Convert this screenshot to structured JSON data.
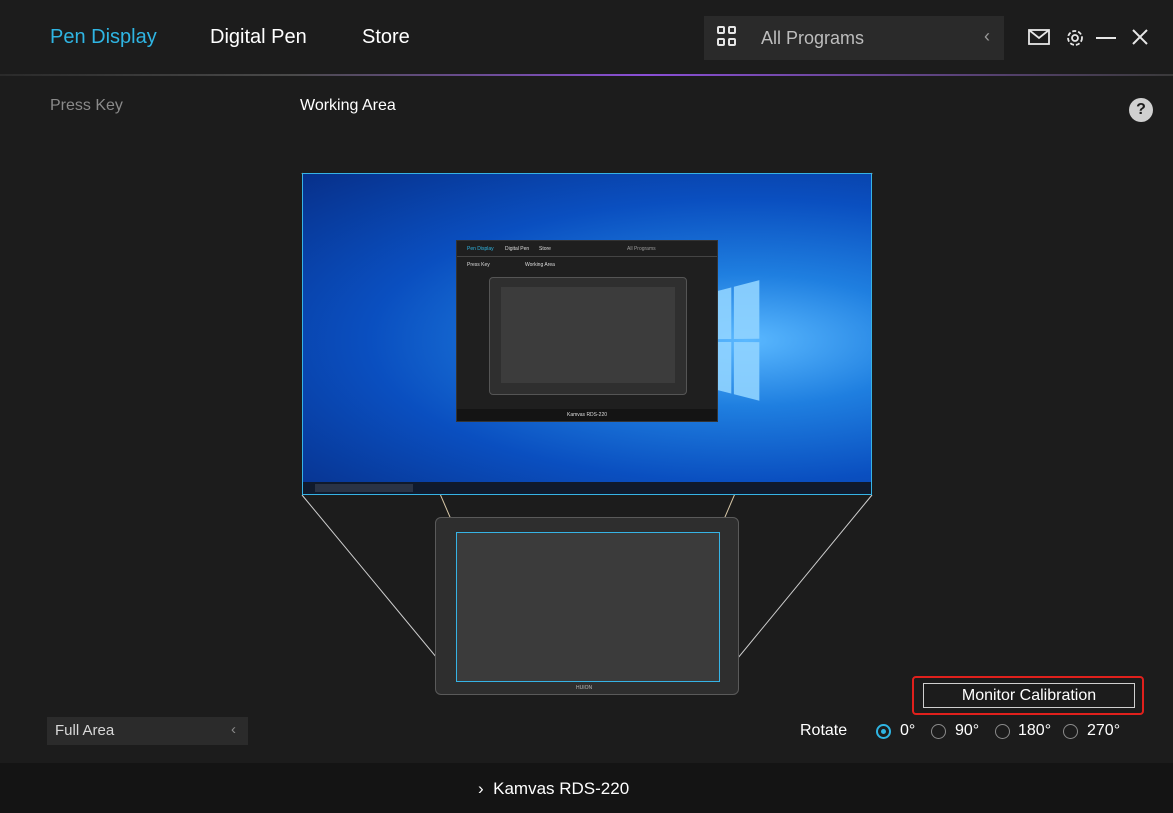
{
  "header": {
    "tabs": [
      {
        "label": "Pen Display",
        "active": true
      },
      {
        "label": "Digital Pen",
        "active": false
      },
      {
        "label": "Store",
        "active": false
      }
    ],
    "program_selector": {
      "value": "All Programs"
    },
    "icons": [
      "grid-icon",
      "chevron-left-icon",
      "mail-icon",
      "gear-icon",
      "minimize-icon",
      "close-icon"
    ]
  },
  "subtabs": [
    {
      "label": "Press Key",
      "active": false
    },
    {
      "label": "Working Area",
      "active": true
    }
  ],
  "help_label": "?",
  "preview": {
    "mini_app": {
      "tabs": [
        "Pen Display",
        "Digital Pen",
        "Store"
      ],
      "program": "All Programs",
      "subtabs": [
        "Press Key",
        "Working Area"
      ],
      "device": "Kamvas RDS-220"
    },
    "tablet_brand": "HUION"
  },
  "area_select": {
    "value": "Full Area"
  },
  "monitor_calibration_label": "Monitor Calibration",
  "rotate": {
    "label": "Rotate",
    "options": [
      "0°",
      "90°",
      "180°",
      "270°"
    ],
    "selected": "0°"
  },
  "footer": {
    "device_name": "Kamvas RDS-220"
  },
  "colors": {
    "accent": "#2fb5e3",
    "highlight": "#e0201c",
    "background": "#1c1c1c"
  }
}
